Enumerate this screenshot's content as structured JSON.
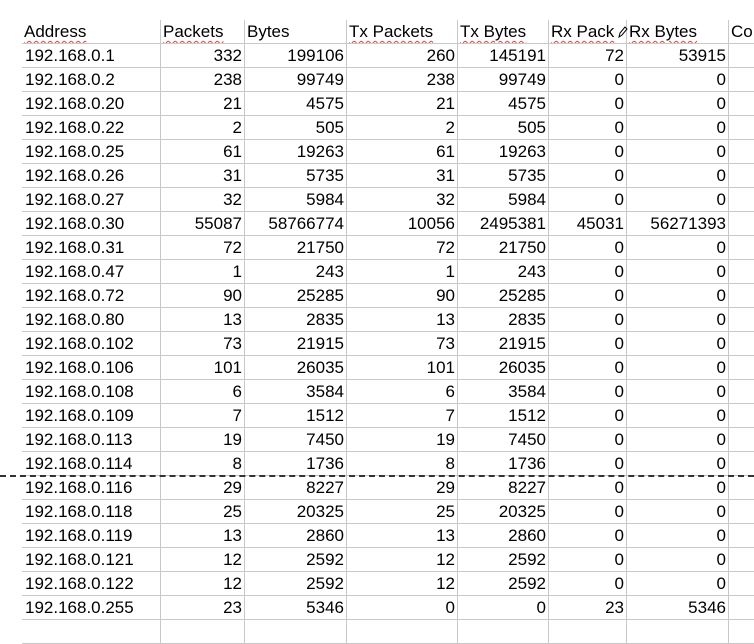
{
  "spreadsheet": {
    "columns": [
      {
        "header": "Address",
        "spellcheck": true,
        "align": "left"
      },
      {
        "header": "Packets",
        "spellcheck": true,
        "align": "right"
      },
      {
        "header": "Bytes",
        "spellcheck": false,
        "align": "right"
      },
      {
        "header": "Tx Packets",
        "spellcheck": true,
        "align": "right"
      },
      {
        "header": "Tx Bytes",
        "spellcheck": true,
        "align": "right"
      },
      {
        "header": "Rx Pack",
        "spellcheck": true,
        "align": "right"
      },
      {
        "header": "Rx Bytes",
        "spellcheck": true,
        "align": "right"
      },
      {
        "header": "Co",
        "spellcheck": false,
        "align": "left"
      }
    ],
    "rows": [
      [
        "192.168.0.1",
        "332",
        "199106",
        "260",
        "145191",
        "72",
        "53915",
        ""
      ],
      [
        "192.168.0.2",
        "238",
        "99749",
        "238",
        "99749",
        "0",
        "0",
        ""
      ],
      [
        "192.168.0.20",
        "21",
        "4575",
        "21",
        "4575",
        "0",
        "0",
        ""
      ],
      [
        "192.168.0.22",
        "2",
        "505",
        "2",
        "505",
        "0",
        "0",
        ""
      ],
      [
        "192.168.0.25",
        "61",
        "19263",
        "61",
        "19263",
        "0",
        "0",
        ""
      ],
      [
        "192.168.0.26",
        "31",
        "5735",
        "31",
        "5735",
        "0",
        "0",
        ""
      ],
      [
        "192.168.0.27",
        "32",
        "5984",
        "32",
        "5984",
        "0",
        "0",
        ""
      ],
      [
        "192.168.0.30",
        "55087",
        "58766774",
        "10056",
        "2495381",
        "45031",
        "56271393",
        ""
      ],
      [
        "192.168.0.31",
        "72",
        "21750",
        "72",
        "21750",
        "0",
        "0",
        ""
      ],
      [
        "192.168.0.47",
        "1",
        "243",
        "1",
        "243",
        "0",
        "0",
        ""
      ],
      [
        "192.168.0.72",
        "90",
        "25285",
        "90",
        "25285",
        "0",
        "0",
        ""
      ],
      [
        "192.168.0.80",
        "13",
        "2835",
        "13",
        "2835",
        "0",
        "0",
        ""
      ],
      [
        "192.168.0.102",
        "73",
        "21915",
        "73",
        "21915",
        "0",
        "0",
        ""
      ],
      [
        "192.168.0.106",
        "101",
        "26035",
        "101",
        "26035",
        "0",
        "0",
        ""
      ],
      [
        "192.168.0.108",
        "6",
        "3584",
        "6",
        "3584",
        "0",
        "0",
        ""
      ],
      [
        "192.168.0.109",
        "7",
        "1512",
        "7",
        "1512",
        "0",
        "0",
        ""
      ],
      [
        "192.168.0.113",
        "19",
        "7450",
        "19",
        "7450",
        "0",
        "0",
        ""
      ],
      [
        "192.168.0.114",
        "8",
        "1736",
        "8",
        "1736",
        "0",
        "0",
        ""
      ],
      [
        "192.168.0.116",
        "29",
        "8227",
        "29",
        "8227",
        "0",
        "0",
        ""
      ],
      [
        "192.168.0.118",
        "25",
        "20325",
        "25",
        "20325",
        "0",
        "0",
        ""
      ],
      [
        "192.168.0.119",
        "13",
        "2860",
        "13",
        "2860",
        "0",
        "0",
        ""
      ],
      [
        "192.168.0.121",
        "12",
        "2592",
        "12",
        "2592",
        "0",
        "0",
        ""
      ],
      [
        "192.168.0.122",
        "12",
        "2592",
        "12",
        "2592",
        "0",
        "0",
        ""
      ],
      [
        "192.168.0.255",
        "23",
        "5346",
        "0",
        "0",
        "23",
        "5346",
        ""
      ],
      [
        "",
        "",
        "",
        "",
        "",
        "",
        "",
        ""
      ]
    ]
  },
  "colors": {
    "gridline": "#c8c8c8",
    "spellcheck_underline": "#e04040",
    "page_break": "#333333"
  },
  "icons": {
    "cursor": "pencil-cursor-icon"
  }
}
